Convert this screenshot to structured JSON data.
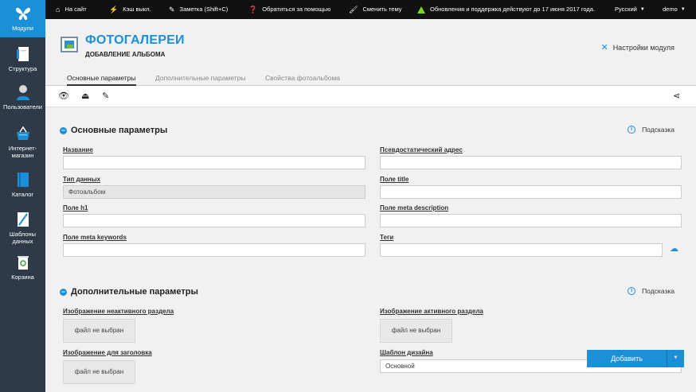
{
  "sidebar": {
    "items": [
      {
        "label": "Модули",
        "icon": "butterfly-icon",
        "active": true
      },
      {
        "label": "Структура",
        "icon": "structure-icon"
      },
      {
        "label": "Пользователи",
        "icon": "users-icon"
      },
      {
        "label": "Интернет-магазин",
        "label1": "Интернет-",
        "label2": "магазин",
        "icon": "basket-icon"
      },
      {
        "label": "Каталог",
        "icon": "catalog-icon"
      },
      {
        "label": "Шаблоны данных",
        "label1": "Шаблоны",
        "label2": "данных",
        "icon": "templates-icon"
      },
      {
        "label": "Корзина",
        "icon": "trash-icon"
      }
    ]
  },
  "topbar": {
    "site": "На сайт",
    "cache": "Кэш выкл.",
    "note": "Заметка (Shift+C)",
    "help": "Обратиться за помощью",
    "theme": "Сменить тему",
    "updates": "Обновления и поддержка действуют до 17 июня 2017 года.",
    "lang": "Русский",
    "user": "demo"
  },
  "header": {
    "title": "ФОТОГАЛЕРЕИ",
    "subtitle": "ДОБАВЛЕНИЕ АЛЬБОМА",
    "module_settings": "Настройки модуля"
  },
  "tabs": [
    {
      "label": "Основные параметры",
      "active": true
    },
    {
      "label": "Дополнительные параметры"
    },
    {
      "label": "Свойства фотоальбома"
    }
  ],
  "section_main": {
    "title": "Основные параметры",
    "hint": "Подсказка",
    "fields": {
      "name_label": "Название",
      "name_value": "",
      "type_label": "Тип данных",
      "type_value": "Фотоальбом",
      "h1_label": "Поле h1",
      "h1_value": "",
      "keywords_label": "Поле meta keywords",
      "keywords_value": "",
      "alias_label": "Псевдостатический адрес",
      "alias_value": "",
      "title_label": "Поле title",
      "title_value": "",
      "description_label": "Поле meta description",
      "description_value": "",
      "tags_label": "Теги",
      "tags_value": ""
    }
  },
  "section_extra": {
    "title": "Дополнительные параметры",
    "hint": "Подсказка",
    "inactive_image_label": "Изображение неактивного раздела",
    "active_image_label": "Изображение активного раздела",
    "header_image_label": "Изображение для заголовка",
    "no_file": "файл не выбран",
    "design_template_label": "Шаблон дизайна",
    "design_template_value": "Основной"
  },
  "actions": {
    "add_label": "Добавить"
  },
  "colors": {
    "accent": "#1b8fd8",
    "sidebar_bg": "#2e3a48",
    "topbar_bg": "#111111"
  }
}
